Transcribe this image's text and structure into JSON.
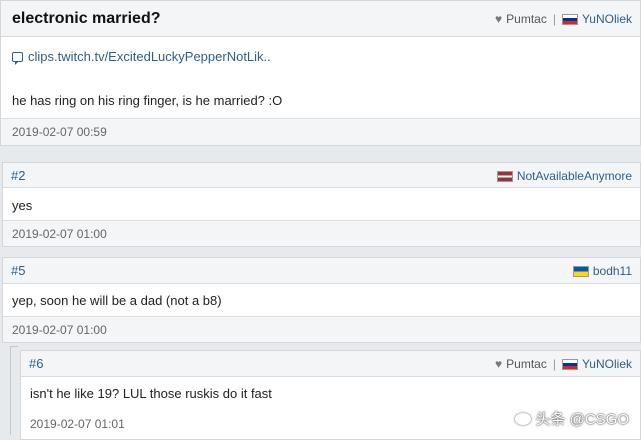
{
  "thread": {
    "title": "electronic married?",
    "author": "YuNOliek",
    "author_flag": "ru",
    "tag": "Pumtac",
    "link_text": "clips.twitch.tv/ExcitedLuckyPepperNotLik..",
    "body": "he has ring on his ring finger, is he married? :O",
    "date": "2019-02-07 00:59"
  },
  "replies": [
    {
      "number": "#2",
      "author": "NotAvailableAnymore",
      "flag": "lv",
      "body": "yes",
      "date": "2019-02-07 01:00"
    },
    {
      "number": "#5",
      "author": "bodh11",
      "flag": "ua",
      "body": "yep, soon he will be a dad (not a b8)",
      "date": "2019-02-07 01:00"
    },
    {
      "number": "#6",
      "author": "YuNOliek",
      "flag": "ru",
      "tag": "Pumtac",
      "body": "isn't he like 19? LUL those ruskis do it fast",
      "date": "2019-02-07 01:01"
    }
  ],
  "watermark": "头条 @CSGO"
}
